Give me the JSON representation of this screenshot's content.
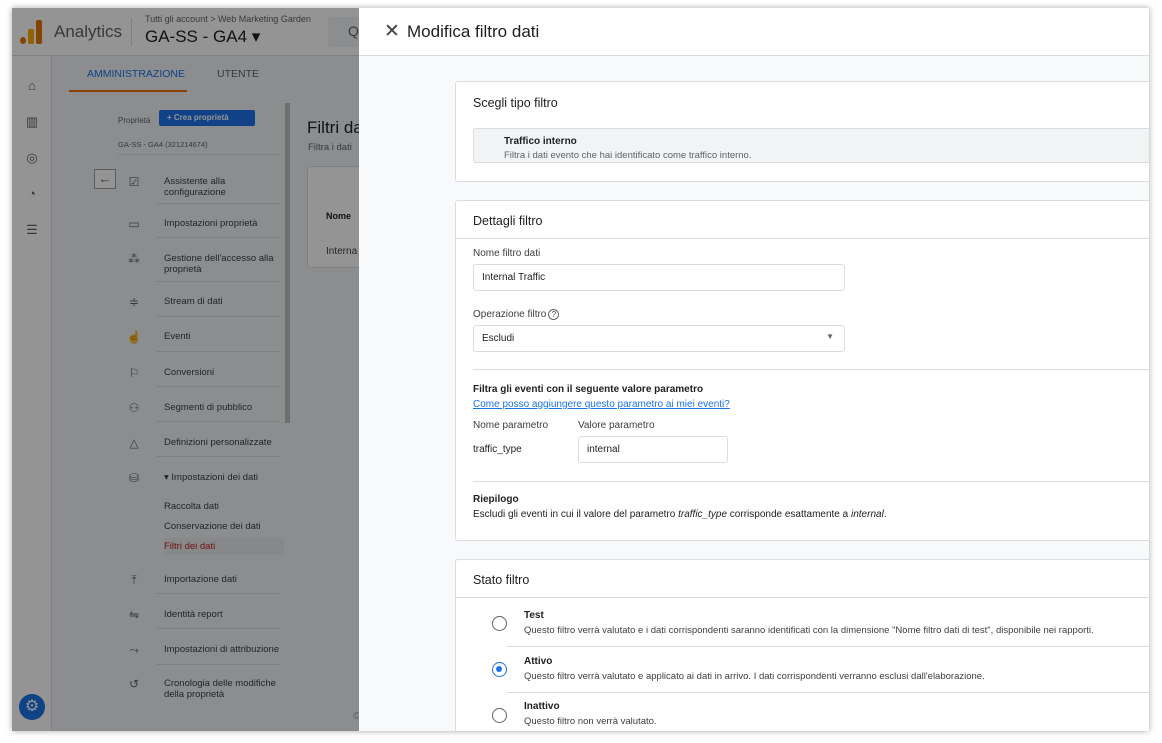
{
  "topbar": {
    "app_name": "Analytics",
    "breadcrumb": "Tutti gli account > Web Marketing Garden",
    "property": "GA-SS - GA4 ▾"
  },
  "admin": {
    "tab_admin": "AMMINISTRAZIONE",
    "tab_user": "UTENTE",
    "property_label": "Proprietà",
    "create_button": "+ Crea proprietà",
    "property_id": "GA-SS - GA4 (321214674)",
    "nav": [
      {
        "icon": "checkbox-icon",
        "label": "Assistente alla configurazione"
      },
      {
        "icon": "layout-icon",
        "label": "Impostazioni proprietà"
      },
      {
        "icon": "people-icon",
        "label": "Gestione dell'accesso alla proprietà"
      },
      {
        "icon": "stream-icon",
        "label": "Stream di dati"
      },
      {
        "icon": "touch-icon",
        "label": "Eventi"
      },
      {
        "icon": "flag-icon",
        "label": "Conversioni"
      },
      {
        "icon": "audience-icon",
        "label": "Segmenti di pubblico"
      },
      {
        "icon": "shapes-icon",
        "label": "Definizioni personalizzate"
      },
      {
        "icon": "database-icon",
        "label": "▾ Impostazioni dei dati"
      },
      {
        "icon": "upload-icon",
        "label": "Importazione dati"
      },
      {
        "icon": "identity-icon",
        "label": "Identità report"
      },
      {
        "icon": "attribution-icon",
        "label": "Impostazioni di attribuzione"
      },
      {
        "icon": "history-icon",
        "label": "Cronologia delle modifiche della proprietà"
      }
    ],
    "sub_items": [
      "Raccolta dati",
      "Conservazione dei dati",
      "Filtri dei dati"
    ]
  },
  "main": {
    "title": "Filtri da",
    "subtitle": "Filtra i dati",
    "col_name": "Nome",
    "row_value": "Interna"
  },
  "footer_text": "©",
  "sheet": {
    "title": "Modifica filtro dati",
    "type_card": {
      "title": "Scegli tipo filtro",
      "type_name": "Traffico interno",
      "type_desc": "Filtra i dati evento che hai identificato come traffico interno."
    },
    "details": {
      "title": "Dettagli filtro",
      "name_label": "Nome filtro dati",
      "name_value": "Internal Traffic",
      "op_label": "Operazione filtro",
      "op_help_icon": "⓪",
      "op_value": "Escludi",
      "param_heading": "Filtra gli eventi con il seguente valore parametro",
      "param_link": "Come posso aggiungere questo parametro ai miei eventi?",
      "param_name_label": "Nome parametro",
      "param_value_label": "Valore parametro",
      "param_name": "traffic_type",
      "param_value": "internal",
      "summary_heading": "Riepilogo",
      "summary_pre": "Escludi gli eventi in cui il valore del parametro ",
      "summary_param": "traffic_type",
      "summary_mid": " corrisponde esattamente a ",
      "summary_value": "internal",
      "summary_end": "."
    },
    "state": {
      "title": "Stato filtro",
      "selected": "Attivo",
      "options": [
        {
          "name": "Test",
          "desc": "Questo filtro verrà valutato e i dati corrispondenti saranno identificati con la dimensione \"Nome filtro dati di test\", disponibile nei rapporti."
        },
        {
          "name": "Attivo",
          "desc": "Questo filtro verrà valutato e applicato ai dati in arrivo. I dati corrispondenti verranno esclusi dall'elaborazione."
        },
        {
          "name": "Inattivo",
          "desc": "Questo filtro non verrà valutato."
        }
      ]
    }
  }
}
